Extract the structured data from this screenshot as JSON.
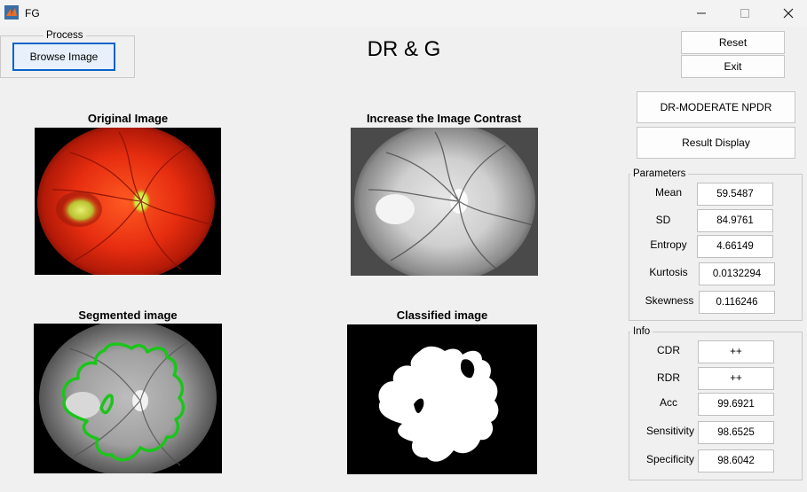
{
  "window": {
    "title": "FG"
  },
  "process": {
    "legend": "Process",
    "browse_label": "Browse Image"
  },
  "app_title": "DR & G",
  "controls": {
    "reset_label": "Reset",
    "exit_label": "Exit"
  },
  "result": {
    "diagnosis": "DR-MODERATE NPDR",
    "display_label": "Result Display"
  },
  "axes": {
    "original": "Original Image",
    "contrast": "Increase the Image Contrast",
    "segmented": "Segmented image",
    "classified": "Classified image"
  },
  "parameters": {
    "legend": "Parameters",
    "items": [
      {
        "label": "Mean",
        "value": "59.5487"
      },
      {
        "label": "SD",
        "value": "84.9761"
      },
      {
        "label": "Entropy",
        "value": "4.66149"
      },
      {
        "label": "Kurtosis",
        "value": "0.0132294"
      },
      {
        "label": "Skewness",
        "value": "0.116246"
      }
    ]
  },
  "info": {
    "legend": "Info",
    "items": [
      {
        "label": "CDR",
        "value": "++"
      },
      {
        "label": "RDR",
        "value": "++"
      },
      {
        "label": "Acc",
        "value": "99.6921"
      },
      {
        "label": "Sensitivity",
        "value": "98.6525"
      },
      {
        "label": "Specificity",
        "value": "98.6042"
      }
    ]
  },
  "colors": {
    "contour": "#1cc41c",
    "fundus_red": "#e02a10"
  }
}
